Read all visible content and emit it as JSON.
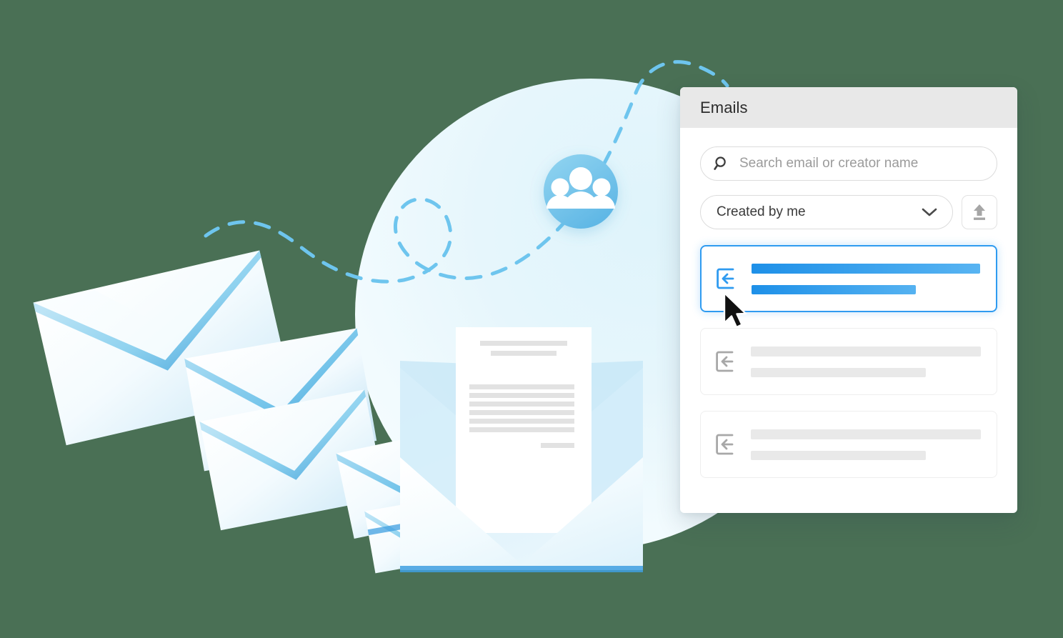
{
  "panel": {
    "title": "Emails",
    "search": {
      "icon": "search-icon",
      "placeholder": "Search email or creator name",
      "value": ""
    },
    "filter": {
      "selected_label": "Created by me",
      "chevron_icon": "chevron-down-icon",
      "options": [
        "Created by me"
      ]
    },
    "upload_button": {
      "icon": "upload-icon",
      "label": ""
    },
    "list": {
      "items": [
        {
          "icon": "inbox-arrow-icon",
          "selected": true,
          "line1": "",
          "line2": ""
        },
        {
          "icon": "inbox-arrow-icon",
          "selected": false,
          "line1": "",
          "line2": ""
        },
        {
          "icon": "inbox-arrow-icon",
          "selected": false,
          "line1": "",
          "line2": ""
        }
      ]
    }
  },
  "illustration": {
    "group_badge_icon": "people-group-icon",
    "cursor_icon": "mouse-pointer-icon",
    "envelope_icon": "envelope-icon",
    "document_icon": "document-icon",
    "dashed_path_icon": "dashed-trajectory-icon"
  },
  "colors": {
    "background": "#4a7055",
    "accent_blue": "#2f9bf0",
    "accent_blue_dark": "#1e90e8",
    "accent_blue_light": "#58b4f2",
    "badge_blue": "#7ec8ec",
    "panel_header_gray": "#e8e8e8",
    "skeleton_gray": "#e9e9e9",
    "placeholder_text": "#9b9b9b",
    "title_text": "#2c2c2c",
    "circle_tint": "#e6f6fc",
    "dashed_line": "#6ec5ee",
    "envelope_flap": "#6fc3e8"
  }
}
